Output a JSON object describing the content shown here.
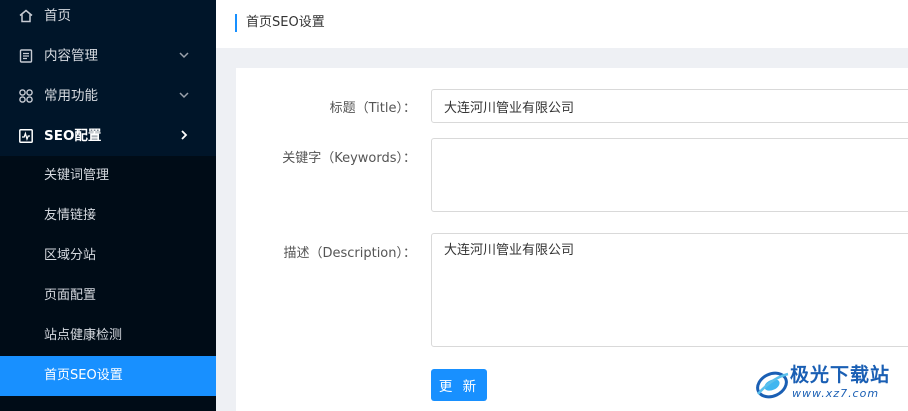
{
  "sidebar": {
    "items": [
      {
        "label": "首页",
        "icon": "home-icon"
      },
      {
        "label": "内容管理",
        "icon": "document-icon"
      },
      {
        "label": "常用功能",
        "icon": "grid-icon"
      },
      {
        "label": "SEO配置",
        "icon": "chart-icon"
      }
    ],
    "submenu": [
      {
        "label": "关键词管理"
      },
      {
        "label": "友情链接"
      },
      {
        "label": "区域分站"
      },
      {
        "label": "页面配置"
      },
      {
        "label": "站点健康检测"
      },
      {
        "label": "首页SEO设置"
      }
    ]
  },
  "header": {
    "title": "首页SEO设置"
  },
  "form": {
    "title_label": "标题（Title）：",
    "title_value": "大连河川管业有限公司",
    "keywords_label": "关键字（Keywords）：",
    "keywords_value": "",
    "description_label": "描述（Description）：",
    "description_value": "大连河川管业有限公司",
    "submit_label": "更 新"
  },
  "watermark": {
    "text": "极光下载站",
    "url": "www.xz7.com"
  },
  "colors": {
    "sidebar_bg": "#001529",
    "accent": "#1890ff"
  }
}
